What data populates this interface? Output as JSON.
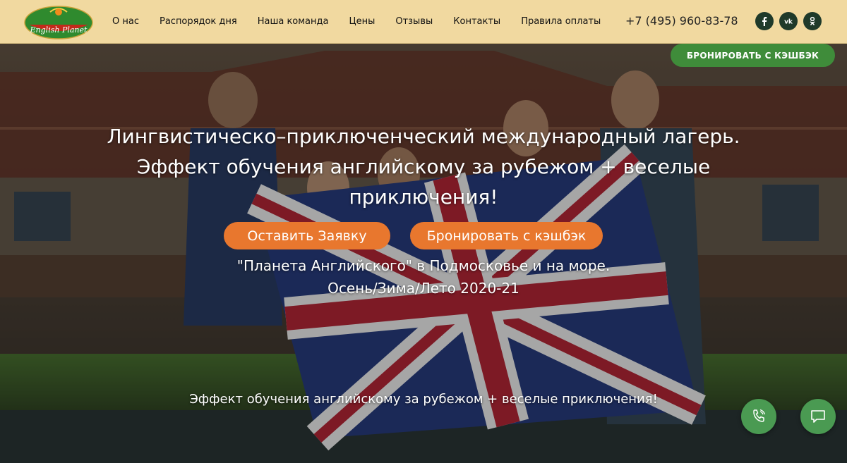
{
  "header": {
    "logo_text": "English Planet",
    "nav": [
      {
        "label": "О нас"
      },
      {
        "label": "Распорядок дня"
      },
      {
        "label": "Наша команда"
      },
      {
        "label": "Цены"
      },
      {
        "label": "Отзывы"
      },
      {
        "label": "Контакты"
      },
      {
        "label": "Правила оплаты"
      }
    ],
    "phone": "+7 (495) 960-83-78",
    "social": [
      {
        "icon": "facebook-icon"
      },
      {
        "icon": "vk-icon"
      },
      {
        "icon": "odnoklassniki-icon"
      }
    ]
  },
  "hero": {
    "book_cashback_top": "БРОНИРОВАТЬ С КЭШБЭК",
    "headline_lines": [
      "Лингвистическо–приключенческий международный лагерь.",
      "Эффект обучения английскому за рубежом + веселые",
      "приключения!"
    ],
    "btn_request": "Оставить Заявку",
    "btn_cashback": "Бронировать с кэшбэк",
    "sub_lines": [
      "\"Планета Английского\" в Подмосковье и на море.",
      "Осень/Зима/Лето 2020-21"
    ],
    "tagline": "Эффект обучения английскому за рубежом + веселые приключения!"
  },
  "widgets": {
    "call_icon": "phone-call-icon",
    "chat_icon": "chat-bubble-icon"
  },
  "colors": {
    "header_bg": "#f1d9a0",
    "accent_orange": "#e8772e",
    "accent_green": "#3f8c3a",
    "social_bg": "#1f3a2a"
  }
}
